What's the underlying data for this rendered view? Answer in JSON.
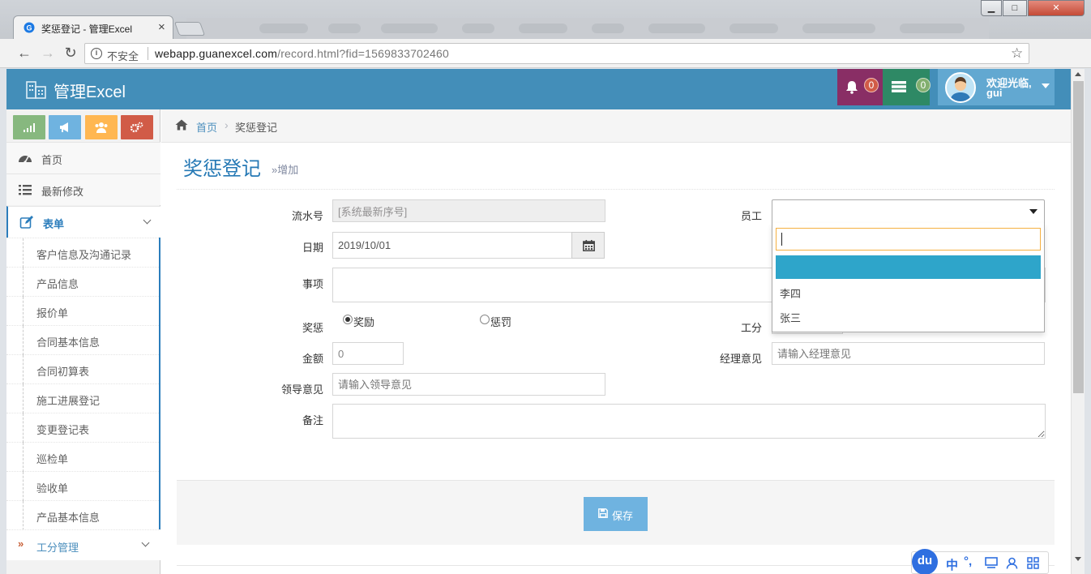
{
  "browser": {
    "tab_title": "奖惩登记 - 管理Excel",
    "security_label": "不安全",
    "url_host": "webapp.guanexcel.com",
    "url_path": "/record.html?fid=1569833702460",
    "close_glyph": "×",
    "min_glyph": "▁",
    "max_glyph": "□",
    "win_close_glyph": "✕"
  },
  "app": {
    "brand": "管理Excel",
    "notifications_count": "0",
    "tasks_count": "0",
    "user": {
      "welcome": "欢迎光临,",
      "name": "gui"
    }
  },
  "sidebar": {
    "home": "首页",
    "recent": "最新修改",
    "forms": "表单",
    "form_items": [
      "客户信息及沟通记录",
      "产品信息",
      "报价单",
      "合同基本信息",
      "合同初算表",
      "施工进展登记",
      "变更登记表",
      "巡检单",
      "验收单",
      "产品基本信息"
    ],
    "work_points": "工分管理"
  },
  "breadcrumb": {
    "home": "首页",
    "current": "奖惩登记"
  },
  "page": {
    "title": "奖惩登记",
    "subtitle": "»增加"
  },
  "form": {
    "serial_label": "流水号",
    "serial_value": "[系统最新序号]",
    "date_label": "日期",
    "date_value": "2019/10/01",
    "matter_label": "事项",
    "reward_punish_label": "奖惩",
    "reward_option": "奖励",
    "punish_option": "惩罚",
    "selected_option": "奖励",
    "amount_label": "金额",
    "amount_value": "0",
    "leader_label": "领导意见",
    "leader_placeholder": "请输入领导意见",
    "remark_label": "备注",
    "employee_label": "员工",
    "employee_options": [
      "李四",
      "张三"
    ],
    "points_label": "工分",
    "manager_label": "经理意见",
    "manager_placeholder": "请输入经理意见",
    "save_label": "保存"
  },
  "ime": {
    "logo": "du",
    "lang": "中",
    "punct": "°,"
  },
  "colors": {
    "navbar": "#438eb9",
    "notif": "#892e65",
    "tasks": "#2e8965",
    "user": "#62a8d1",
    "accent": "#2679b5",
    "highlight": "#2ea5ca",
    "save_button": "#6fb3e0"
  },
  "icons": {
    "shortcuts": [
      "signal-icon",
      "bullhorn-icon",
      "users-icon",
      "cogs-icon"
    ],
    "menu": [
      "tachometer-icon",
      "list-icon",
      "pencil-square-icon"
    ],
    "calendar": "calendar-icon",
    "save": "floppy-icon"
  }
}
